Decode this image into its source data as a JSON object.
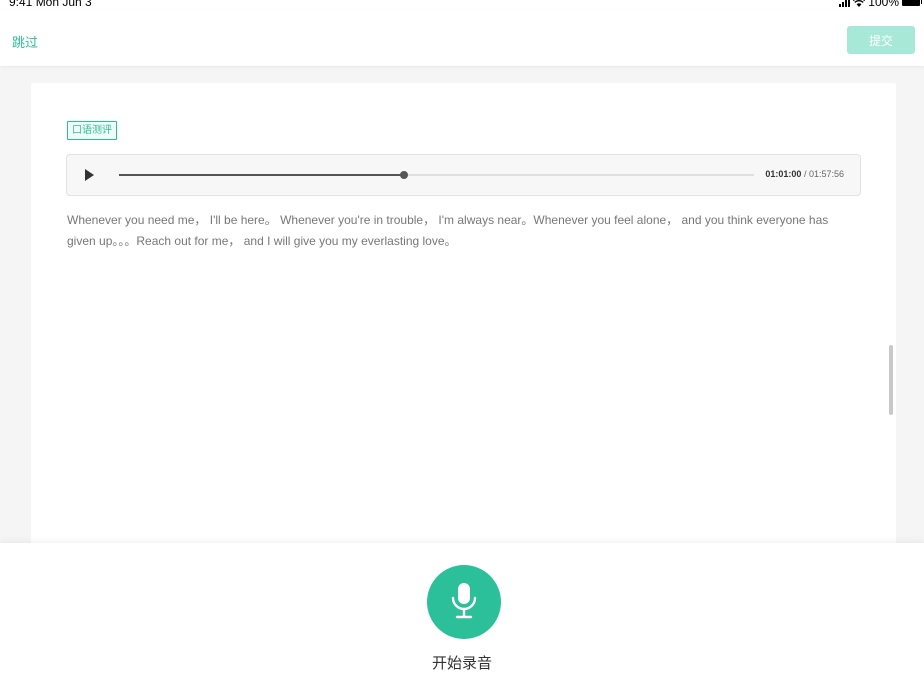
{
  "status_bar": {
    "time": "9:41  Mon Jun 3",
    "battery": "100%"
  },
  "nav": {
    "skip_label": "跳过",
    "submit_label": "提交"
  },
  "card": {
    "tag_label": "口语测评",
    "audio": {
      "current_time": "01:01:00",
      "separator": " / ",
      "total_time": "01:57:56",
      "progress_fraction": 0.449
    },
    "passage": "Whenever you need me， I'll be here。 Whenever you're in trouble， I'm always near。Whenever you feel alone， and you think everyone has given up。。。Reach out for me， and I will give you my everlasting love。"
  },
  "bottom": {
    "record_label": "开始录音"
  },
  "colors": {
    "accent": "#2bbf9a",
    "submit_disabled": "#a8e8d6"
  }
}
